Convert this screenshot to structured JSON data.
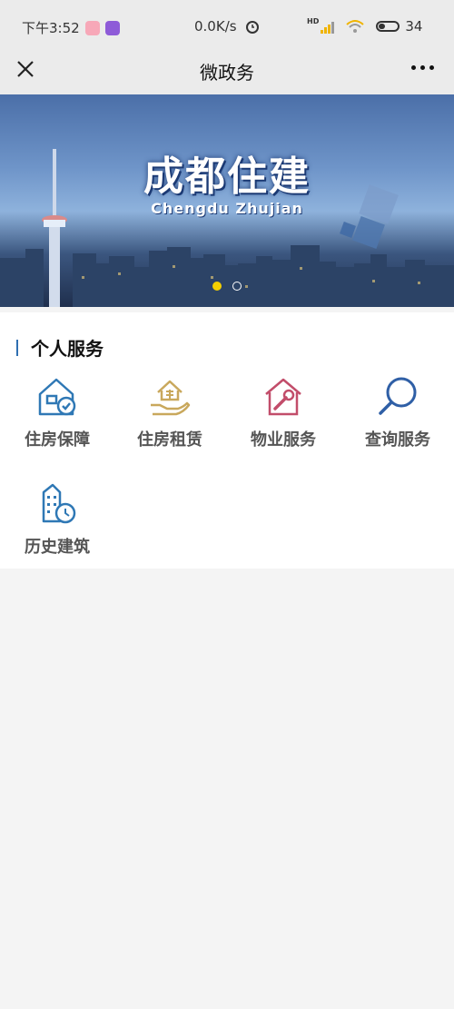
{
  "status_bar": {
    "time": "下午3:52",
    "network_speed": "0.0K/s",
    "network_badge": "HD",
    "battery": "34"
  },
  "nav": {
    "title": "微政务"
  },
  "banner": {
    "title": "成都住建",
    "subtitle": "Chengdu Zhujian",
    "slide_count": 2,
    "active_slide": 1
  },
  "personal_services": {
    "title": "个人服务",
    "items": [
      {
        "label": "住房保障",
        "icon": "house-check-icon",
        "color": "#2f78b5"
      },
      {
        "label": "住房租赁",
        "icon": "hand-house-icon",
        "color": "#c9a85c"
      },
      {
        "label": "物业服务",
        "icon": "house-wrench-icon",
        "color": "#c24d6a"
      },
      {
        "label": "查询服务",
        "icon": "search-icon",
        "color": "#2f5fa6"
      },
      {
        "label": "历史建筑",
        "icon": "building-clock-icon",
        "color": "#2f78b5"
      }
    ]
  }
}
